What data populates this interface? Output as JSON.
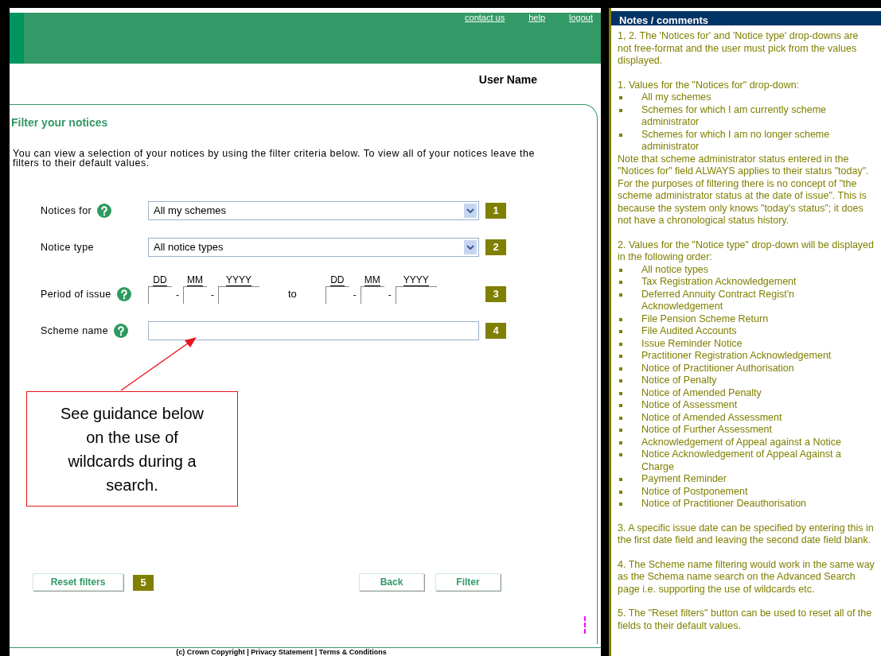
{
  "header": {
    "links": [
      "contact us",
      "help",
      "logout"
    ],
    "user_name": "User Name"
  },
  "filter": {
    "title": "Filter your notices",
    "description": "You can view a selection of your notices by using the filter criteria below. To view all of your notices leave the filters to their default values.",
    "rows": [
      {
        "kind": "select",
        "label": "Notices for",
        "help": true,
        "value": "All my schemes",
        "badge": "1"
      },
      {
        "kind": "select",
        "label": "Notice type",
        "help": false,
        "value": "All notice types",
        "badge": "2"
      },
      {
        "kind": "date_range",
        "label": "Period of issue",
        "help": true,
        "badge": "3",
        "segments": [
          {
            "kind": "input",
            "label": "DD"
          },
          {
            "kind": "sep",
            "text": "-"
          },
          {
            "kind": "input",
            "label": "MM"
          },
          {
            "kind": "sep",
            "text": "-"
          },
          {
            "kind": "year_input",
            "label": "YYYY"
          },
          {
            "kind": "to",
            "text": "to"
          },
          {
            "kind": "input",
            "label": "DD"
          },
          {
            "kind": "sep",
            "text": "-"
          },
          {
            "kind": "input",
            "label": "MM"
          },
          {
            "kind": "sep",
            "text": "-"
          },
          {
            "kind": "year_input",
            "label": "YYYY"
          }
        ]
      },
      {
        "kind": "text",
        "label": "Scheme name",
        "help": true,
        "badge": "4"
      }
    ],
    "callout": "See guidance below on the use of wildcards during a search.",
    "buttons": [
      {
        "label": "Reset filters",
        "badge": "5"
      },
      {
        "label": "Back"
      },
      {
        "label": "Filter"
      }
    ],
    "footer": "(c) Crown Copyright | Privacy Statement | Terms & Conditions"
  },
  "notes": {
    "title": "Notes / comments",
    "sections": [
      {
        "items": [
          {
            "kind": "para",
            "text": "1, 2. The 'Notices for' and 'Notice type' drop-downs are not free-format and the user must pick from the values displayed."
          }
        ]
      },
      {
        "items": [
          {
            "kind": "para",
            "text": "1. Values for the \"Notices for\" drop-down:"
          },
          {
            "kind": "bullets",
            "items": [
              "All my schemes",
              "Schemes for which I am currently scheme administrator",
              "Schemes for which I am no longer scheme administrator"
            ]
          },
          {
            "kind": "para",
            "text": "Note that scheme administrator status entered in the \"Notices for\" field ALWAYS applies to their status \"today\". For the purposes of filtering there is no concept of \"the scheme administrator status at the date of issue\". This is because the system only knows \"today's status\"; it does not have a chronological status history."
          }
        ]
      },
      {
        "items": [
          {
            "kind": "para",
            "text": "2. Values for the \"Notice type\" drop-down will be displayed in the following order:"
          },
          {
            "kind": "bullets",
            "items": [
              "All notice types",
              "Tax Registration Acknowledgement",
              "Deferred Annuity Contract Regist'n Acknowledgement",
              "File Pension Scheme Return",
              "File Audited Accounts",
              "Issue Reminder Notice",
              "Practitioner Registration Acknowledgement",
              "Notice of Practitioner Authorisation",
              "Notice of Penalty",
              "Notice of Amended Penalty",
              "Notice of Assessment",
              "Notice of Amended Assessment",
              "Notice of Further Assessment",
              "Acknowledgement of Appeal against a Notice",
              "Notice Acknowledgement of Appeal Against a Charge",
              "Payment Reminder",
              "Notice of Postponement",
              "Notice of Practitioner Deauthorisation"
            ]
          }
        ]
      },
      {
        "items": [
          {
            "kind": "para",
            "text": "3. A specific issue date can be specified by entering this in the first date field and leaving the second date field blank."
          }
        ]
      },
      {
        "items": [
          {
            "kind": "para",
            "text": "4. The Scheme name filtering would work in the same way as the Schema name search on the Advanced Search page i.e. supporting the use of wildcards etc."
          }
        ]
      },
      {
        "items": [
          {
            "kind": "para",
            "text": "5. The \"Reset filters\" button can be used to reset all of the fields to their default values."
          }
        ]
      }
    ]
  }
}
